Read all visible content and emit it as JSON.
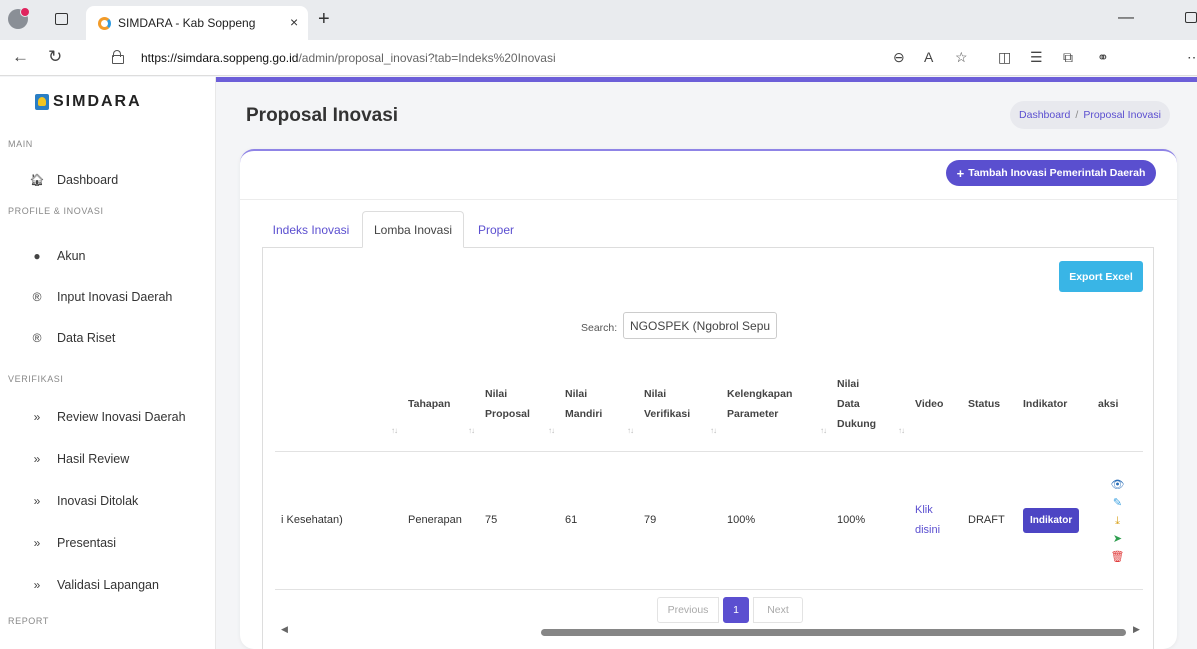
{
  "browser": {
    "tab_title": "SIMDARA - Kab Soppeng",
    "tab_close": "×",
    "new_tab": "+",
    "url_host": "https://simdara.soppeng.go.id",
    "url_path": "/admin/proposal_inovasi?tab=Indeks%20Inovasi"
  },
  "sidebar": {
    "logo": "SIMDARA",
    "sections": {
      "main": "MAIN",
      "profile": "PROFILE & INOVASI",
      "verifikasi": "VERIFIKASI",
      "report": "REPORT"
    },
    "items": [
      {
        "label": "Dashboard",
        "icon": "home-icon"
      },
      {
        "label": "Akun",
        "icon": "user-icon"
      },
      {
        "label": "Input Inovasi Daerah",
        "icon": "registered-icon"
      },
      {
        "label": "Data Riset",
        "icon": "registered-icon"
      },
      {
        "label": "Review Inovasi Daerah",
        "icon": "double-check-icon"
      },
      {
        "label": "Hasil Review",
        "icon": "double-check-icon"
      },
      {
        "label": "Inovasi Ditolak",
        "icon": "double-check-icon"
      },
      {
        "label": "Presentasi",
        "icon": "double-check-icon"
      },
      {
        "label": "Validasi Lapangan",
        "icon": "double-check-icon"
      }
    ]
  },
  "header": {
    "title": "Proposal Inovasi",
    "breadcrumb_home": "Dashboard",
    "breadcrumb_sep": "/",
    "breadcrumb_current": "Proposal Inovasi"
  },
  "card": {
    "add_button": "Tambah Inovasi Pemerintah Daerah",
    "tabs": [
      "Indeks Inovasi",
      "Lomba Inovasi",
      "Proper"
    ],
    "active_tab": "Lomba Inovasi",
    "export_button": "Export Excel",
    "search_label": "Search:",
    "search_value": "NGOSPEK (Ngobrol Sepu"
  },
  "table": {
    "headers": {
      "tahapan": "Tahapan",
      "nilai_proposal_1": "Nilai",
      "nilai_proposal_2": "Proposal",
      "nilai_mandiri_1": "Nilai",
      "nilai_mandiri_2": "Mandiri",
      "nilai_verifikasi_1": "Nilai",
      "nilai_verifikasi_2": "Verifikasi",
      "kelengkapan_1": "Kelengkapan",
      "kelengkapan_2": "Parameter",
      "data_dukung_1": "Nilai",
      "data_dukung_2": "Data",
      "data_dukung_3": "Dukung",
      "video": "Video",
      "status": "Status",
      "indikator": "Indikator",
      "aksi": "aksi"
    },
    "sort_glyph": "↑↓",
    "row": {
      "nama": "i Kesehatan)",
      "tahapan": "Penerapan",
      "nilai_proposal": "75",
      "nilai_mandiri": "61",
      "nilai_verifikasi": "79",
      "kelengkapan": "100%",
      "data_dukung": "100%",
      "video_1": "Klik",
      "video_2": "disini",
      "status": "DRAFT",
      "indikator_button": "Indikator"
    }
  },
  "pagination": {
    "previous": "Previous",
    "current": "1",
    "next": "Next"
  },
  "colors": {
    "accent": "#5a4fcf",
    "export": "#39b5e6",
    "view": "#2c6fb8",
    "edit": "#39a0e0",
    "download": "#d9a21b",
    "send": "#2e9e4f",
    "delete": "#e03b3b"
  }
}
